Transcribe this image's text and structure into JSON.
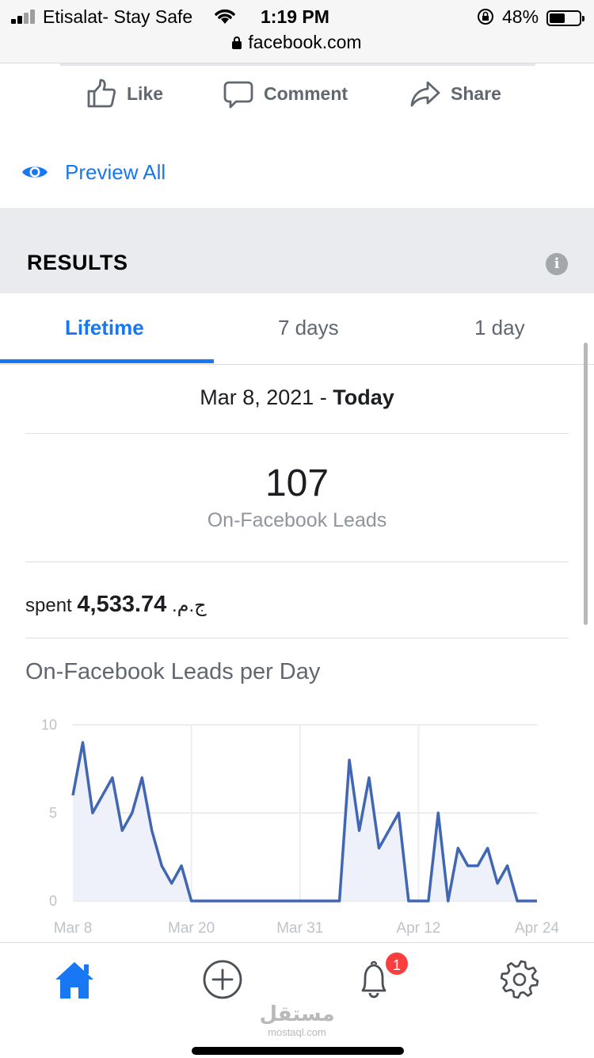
{
  "status_bar": {
    "carrier": "Etisalat- Stay Safe",
    "time": "1:19 PM",
    "battery": "48%",
    "battery_level": 0.48,
    "url": "facebook.com"
  },
  "post_actions": {
    "like": "Like",
    "comment": "Comment",
    "share": "Share"
  },
  "preview_all": "Preview All",
  "results": {
    "title": "RESULTS",
    "info_icon": "i"
  },
  "tabs": [
    {
      "label": "Lifetime",
      "active": true
    },
    {
      "label": "7 days",
      "active": false
    },
    {
      "label": "1 day",
      "active": false
    }
  ],
  "date_range": {
    "start": "Mar 8, 2021 - ",
    "end": "Today"
  },
  "leads": {
    "value": "107",
    "label": "On-Facebook Leads"
  },
  "spent": {
    "word": "spent",
    "currency": "ج.م.",
    "amount": "4,533.74"
  },
  "chart_title": "On-Facebook Leads per Day",
  "chart_data": {
    "type": "area",
    "title": "On-Facebook Leads per Day",
    "xlabel": "",
    "ylabel": "",
    "ylim": [
      0,
      10
    ],
    "yticks": [
      "0",
      "5",
      "10"
    ],
    "xticks": [
      "Mar 8",
      "Mar 20",
      "Mar 31",
      "Apr 12",
      "Apr 24"
    ],
    "grid": true,
    "color": "#4267b2",
    "fill": "#eef1f9",
    "series": [
      {
        "x": [
          "Mar 8",
          "Mar 9",
          "Mar 10",
          "Mar 11",
          "Mar 12",
          "Mar 13",
          "Mar 14",
          "Mar 15",
          "Mar 16",
          "Mar 17",
          "Mar 18",
          "Mar 19",
          "Mar 20",
          "Mar 21",
          "Mar 22",
          "Mar 23",
          "Mar 24",
          "Mar 25",
          "Mar 26",
          "Mar 27",
          "Mar 28",
          "Mar 29",
          "Mar 30",
          "Mar 31",
          "Apr 1",
          "Apr 2",
          "Apr 3",
          "Apr 4",
          "Apr 5",
          "Apr 6",
          "Apr 7",
          "Apr 8",
          "Apr 9",
          "Apr 10",
          "Apr 11",
          "Apr 12",
          "Apr 13",
          "Apr 14",
          "Apr 15",
          "Apr 16",
          "Apr 17",
          "Apr 18",
          "Apr 19",
          "Apr 20",
          "Apr 21",
          "Apr 22",
          "Apr 23",
          "Apr 24"
        ],
        "values": [
          6,
          9,
          5,
          6,
          7,
          4,
          5,
          7,
          4,
          2,
          1,
          2,
          0,
          0,
          0,
          0,
          0,
          0,
          0,
          0,
          0,
          0,
          0,
          0,
          0,
          0,
          0,
          0,
          8,
          4,
          7,
          3,
          4,
          5,
          0,
          0,
          0,
          5,
          0,
          3,
          2,
          2,
          3,
          1,
          2,
          0,
          0,
          0
        ]
      }
    ]
  },
  "bottom_nav": {
    "items": [
      "home-icon",
      "add-icon",
      "bell-icon",
      "gear-icon"
    ],
    "notification_count": "1",
    "accent": "#1877f2"
  },
  "watermark": {
    "arabic": "مستقل",
    "latin": "mostaql.com"
  }
}
